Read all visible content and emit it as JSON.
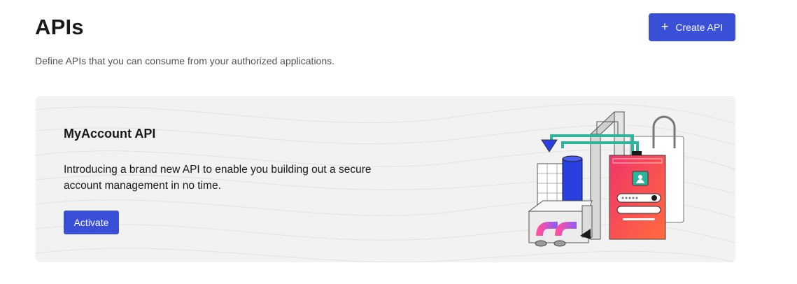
{
  "header": {
    "title": "APIs",
    "description": "Define APIs that you can consume from your authorized applications.",
    "create_button_label": "Create API",
    "create_button_icon": "plus-icon"
  },
  "promo_card": {
    "title": "MyAccount API",
    "description": "Introducing a brand new API to enable you building out a secure account management in no time.",
    "activate_button_label": "Activate",
    "illustration": "account-machine-illustration"
  },
  "colors": {
    "primary": "#3a4fd8",
    "card_background": "#f2f2f2",
    "illustration_pink": "#f0356a",
    "illustration_blue": "#2a3fe0",
    "illustration_teal": "#2db49b"
  }
}
